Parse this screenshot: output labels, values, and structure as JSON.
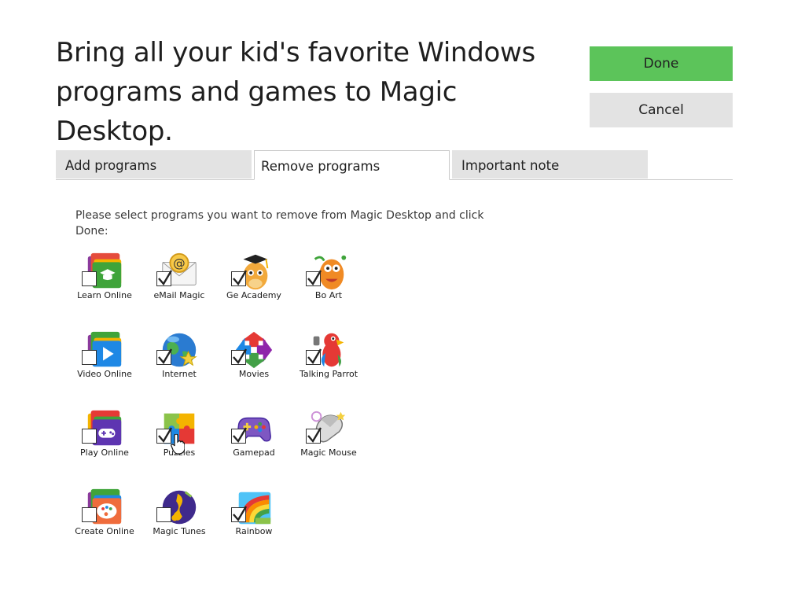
{
  "header": {
    "line1": "Bring all your kid's favorite Windows",
    "line2": "programs and games to Magic Desktop."
  },
  "buttons": {
    "done": "Done",
    "cancel": "Cancel"
  },
  "tabs": [
    {
      "label": "Add programs",
      "active": false
    },
    {
      "label": "Remove programs",
      "active": true
    },
    {
      "label": "Important note",
      "active": false
    }
  ],
  "instruction": {
    "line1": "Please select programs you want to remove from Magic Desktop and click",
    "line2": "Done:"
  },
  "programs": [
    {
      "label": "Learn Online",
      "checked": false,
      "icon": "folder-graduation-cap-icon"
    },
    {
      "label": "eMail Magic",
      "checked": true,
      "icon": "envelope-at-icon"
    },
    {
      "label": "Ge Academy",
      "checked": true,
      "icon": "giraffe-graduate-icon"
    },
    {
      "label": "Bo Art",
      "checked": true,
      "icon": "monster-artist-icon"
    },
    {
      "label": "Video Online",
      "checked": false,
      "icon": "folder-play-icon"
    },
    {
      "label": "Internet",
      "checked": true,
      "icon": "globe-star-icon"
    },
    {
      "label": "Movies",
      "checked": true,
      "icon": "film-arrows-icon"
    },
    {
      "label": "Talking Parrot",
      "checked": true,
      "icon": "parrot-icon"
    },
    {
      "label": "Play Online",
      "checked": false,
      "icon": "folder-gamepad-icon"
    },
    {
      "label": "Puzzles",
      "checked": true,
      "icon": "puzzle-pieces-icon"
    },
    {
      "label": "Gamepad",
      "checked": true,
      "icon": "gamepad-icon"
    },
    {
      "label": "Magic Mouse",
      "checked": true,
      "icon": "computer-mouse-icon"
    },
    {
      "label": "Create Online",
      "checked": false,
      "icon": "folder-palette-icon"
    },
    {
      "label": "Magic Tunes",
      "checked": false,
      "icon": "music-note-icon"
    },
    {
      "label": "Rainbow",
      "checked": true,
      "icon": "rainbow-icon"
    }
  ],
  "colors": {
    "done_button": "#5cc45a",
    "neutral_button": "#e3e3e3",
    "tab_border": "#c9c9c9"
  }
}
